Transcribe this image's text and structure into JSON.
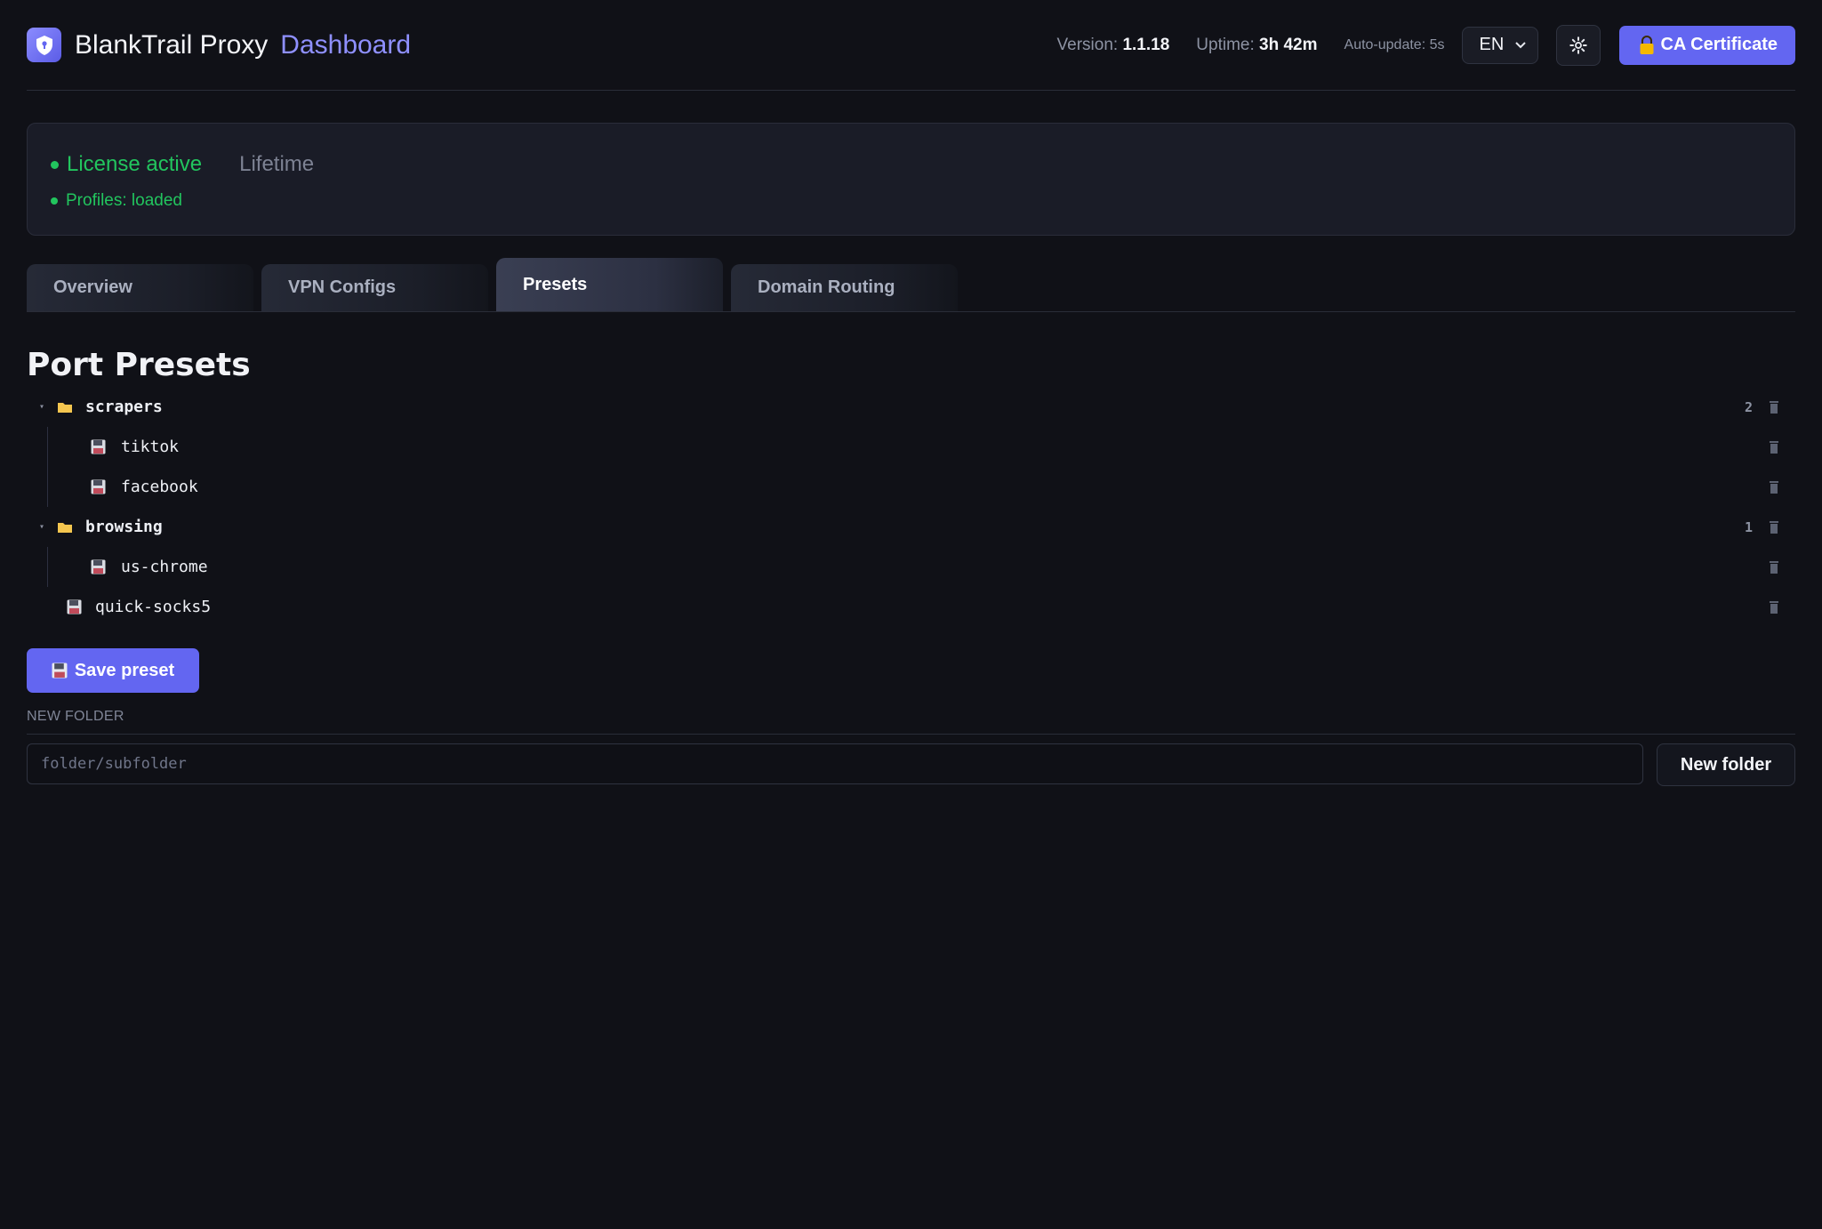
{
  "header": {
    "brand": "BlankTrail Proxy",
    "brand_sub": "Dashboard",
    "version_label": "Version:",
    "version_value": "1.1.18",
    "uptime_label": "Uptime:",
    "uptime_value": "3h 42m",
    "auto_update": "Auto-update: 5s",
    "language": "EN",
    "ca_button": "CA Certificate"
  },
  "license": {
    "status": "License active",
    "type": "Lifetime",
    "profiles": "Profiles: loaded"
  },
  "tabs": [
    {
      "label": "Overview",
      "active": false
    },
    {
      "label": "VPN Configs",
      "active": false
    },
    {
      "label": "Presets",
      "active": true
    },
    {
      "label": "Domain Routing",
      "active": false
    }
  ],
  "presets": {
    "title": "Port Presets",
    "folders": [
      {
        "name": "scrapers",
        "count": "2",
        "items": [
          "tiktok",
          "facebook"
        ]
      },
      {
        "name": "browsing",
        "count": "1",
        "items": [
          "us-chrome"
        ]
      }
    ],
    "root_items": [
      "quick-socks5"
    ],
    "save_button": "Save preset",
    "new_folder_label": "NEW FOLDER",
    "new_folder_placeholder": "folder/subfolder",
    "new_folder_button": "New folder"
  },
  "colors": {
    "accent": "#6366f1",
    "success": "#22c55e",
    "background": "#101117"
  }
}
